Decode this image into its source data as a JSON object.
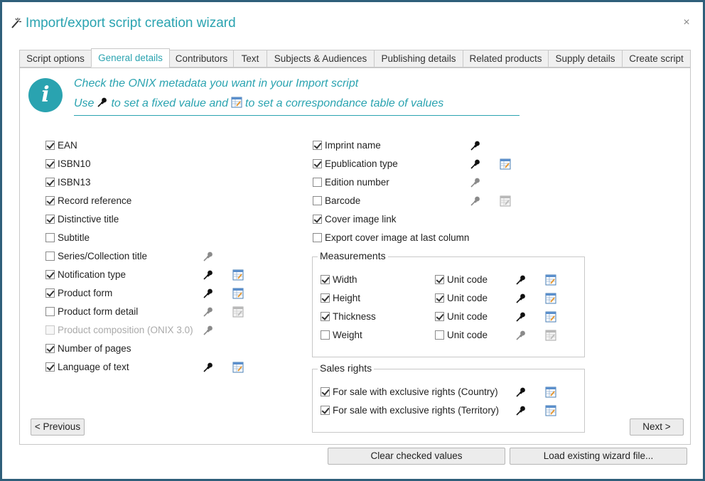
{
  "window": {
    "title": "Import/export script creation wizard",
    "close_label": "×",
    "title_icon": "magic-wand-icon",
    "accent_color": "#2aa3b0"
  },
  "tabs": [
    {
      "label": "Script options",
      "active": false
    },
    {
      "label": "General details",
      "active": true
    },
    {
      "label": "Contributors",
      "active": false
    },
    {
      "label": "Text",
      "active": false
    },
    {
      "label": "Subjects & Audiences",
      "active": false
    },
    {
      "label": "Publishing details",
      "active": false
    },
    {
      "label": "Related products",
      "active": false
    },
    {
      "label": "Supply details",
      "active": false
    },
    {
      "label": "Create script",
      "active": false
    }
  ],
  "info": {
    "icon": "info-icon",
    "line1": "Check the ONIX metadata you want in your Import script",
    "line2_a": "Use",
    "line2_b": "to set a fixed value and",
    "line2_c": "to set a correspondance table of values"
  },
  "left_fields": [
    {
      "label": "EAN",
      "checked": true,
      "disabled": false,
      "pin": null,
      "table": null
    },
    {
      "label": "ISBN10",
      "checked": true,
      "disabled": false,
      "pin": null,
      "table": null
    },
    {
      "label": "ISBN13",
      "checked": true,
      "disabled": false,
      "pin": null,
      "table": null
    },
    {
      "label": "Record reference",
      "checked": true,
      "disabled": false,
      "pin": null,
      "table": null
    },
    {
      "label": "Distinctive title",
      "checked": true,
      "disabled": false,
      "pin": null,
      "table": null
    },
    {
      "label": "Subtitle",
      "checked": false,
      "disabled": false,
      "pin": null,
      "table": null
    },
    {
      "label": "Series/Collection title",
      "checked": false,
      "disabled": false,
      "pin": "inactive",
      "table": null
    },
    {
      "label": "Notification type",
      "checked": true,
      "disabled": false,
      "pin": "active",
      "table": "active"
    },
    {
      "label": "Product form",
      "checked": true,
      "disabled": false,
      "pin": "active",
      "table": "active"
    },
    {
      "label": "Product form detail",
      "checked": false,
      "disabled": false,
      "pin": "inactive",
      "table": "inactive"
    },
    {
      "label": "Product composition (ONIX 3.0)",
      "checked": false,
      "disabled": true,
      "pin": "inactive",
      "table": null
    },
    {
      "label": "Number of pages",
      "checked": true,
      "disabled": false,
      "pin": null,
      "table": null
    },
    {
      "label": "Language of text",
      "checked": true,
      "disabled": false,
      "pin": "active",
      "table": "active"
    }
  ],
  "right_fields": [
    {
      "label": "Imprint name",
      "checked": true,
      "pin": "active",
      "table": null
    },
    {
      "label": "Epublication type",
      "checked": true,
      "pin": "active",
      "table": "active"
    },
    {
      "label": "Edition number",
      "checked": false,
      "pin": "inactive",
      "table": null
    },
    {
      "label": "Barcode",
      "checked": false,
      "pin": "inactive",
      "table": "inactive"
    },
    {
      "label": "Cover image link",
      "checked": true,
      "pin": null,
      "table": null
    },
    {
      "label": "Export cover image at last column",
      "checked": false,
      "pin": null,
      "table": null
    }
  ],
  "measurements": {
    "title": "Measurements",
    "rows": [
      {
        "label": "Width",
        "checked": true,
        "unit_label": "Unit code",
        "unit_checked": true,
        "pin": "active",
        "table": "active"
      },
      {
        "label": "Height",
        "checked": true,
        "unit_label": "Unit code",
        "unit_checked": true,
        "pin": "active",
        "table": "active"
      },
      {
        "label": "Thickness",
        "checked": true,
        "unit_label": "Unit code",
        "unit_checked": true,
        "pin": "active",
        "table": "active"
      },
      {
        "label": "Weight",
        "checked": false,
        "unit_label": "Unit code",
        "unit_checked": false,
        "pin": "inactive",
        "table": "inactive"
      }
    ]
  },
  "sales_rights": {
    "title": "Sales rights",
    "rows": [
      {
        "label": "For sale with exclusive rights (Country)",
        "checked": true,
        "pin": "active",
        "table": "active"
      },
      {
        "label": "For sale with exclusive rights (Territory)",
        "checked": true,
        "pin": "active",
        "table": "active"
      }
    ]
  },
  "buttons": {
    "previous": "< Previous",
    "next": "Next >",
    "clear": "Clear checked values",
    "load": "Load existing wizard file..."
  }
}
